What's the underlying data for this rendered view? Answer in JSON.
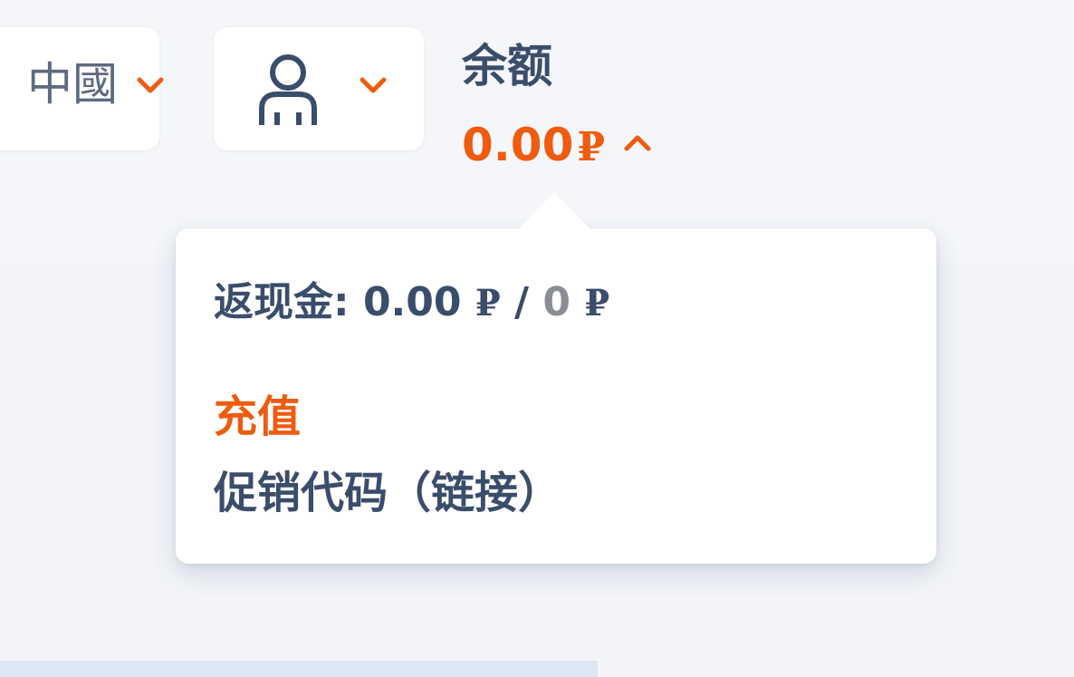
{
  "colors": {
    "accent": "#ef5b0f",
    "text": "#3a4d6b",
    "muted": "#8a8d92",
    "background": "#f2f4f8",
    "card": "#ffffff"
  },
  "header": {
    "language_select": {
      "value": "中國",
      "icon": "chevron-down-icon"
    },
    "user_menu": {
      "icon": "user-icon",
      "chevron": "chevron-down-icon"
    },
    "balance": {
      "label": "余额",
      "amount": "0.00",
      "currency": "₽",
      "chevron": "chevron-up-icon"
    }
  },
  "balance_popover": {
    "cashback": {
      "label": "返现金:",
      "current": "0.00",
      "separator": "/",
      "limit": "0",
      "currency": "₽"
    },
    "topup_label": "充值",
    "promo_label": "促销代码（链接）"
  }
}
